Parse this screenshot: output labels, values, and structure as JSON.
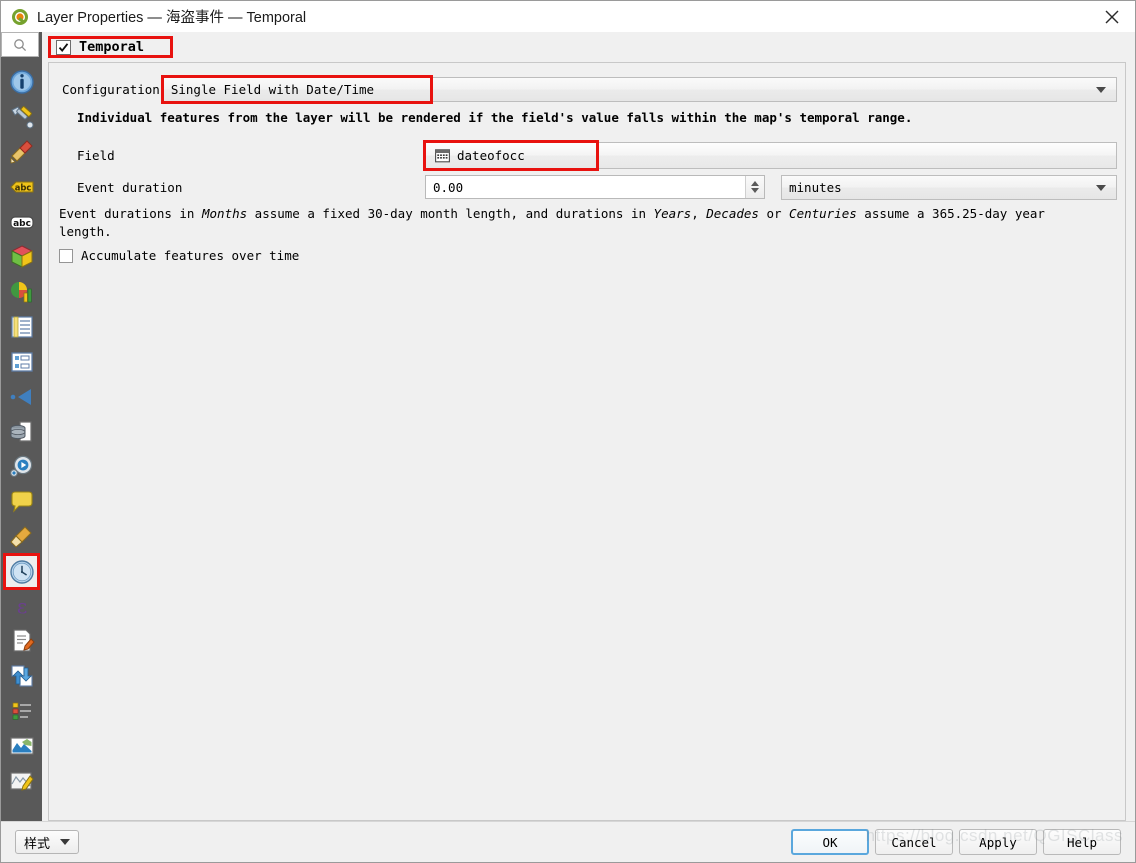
{
  "window": {
    "title": "Layer Properties — 海盗事件 — Temporal",
    "logo_icon": "qgis-logo-icon",
    "close_icon": "close-icon"
  },
  "sidebar": {
    "search": {
      "icon": "search-icon",
      "placeholder": ""
    },
    "items": [
      {
        "name": "information",
        "icon": "info-icon"
      },
      {
        "name": "source",
        "icon": "wrench-screwdriver-icon"
      },
      {
        "name": "symbology",
        "icon": "paintbrush-icon"
      },
      {
        "name": "labels",
        "icon": "abc-label-icon"
      },
      {
        "name": "masks",
        "icon": "abc-outline-icon"
      },
      {
        "name": "3d-view",
        "icon": "cube-icon"
      },
      {
        "name": "diagrams",
        "icon": "pie-bar-chart-icon"
      },
      {
        "name": "fields",
        "icon": "table-fields-icon"
      },
      {
        "name": "attributes-form",
        "icon": "form-layout-icon"
      },
      {
        "name": "joins",
        "icon": "join-arrow-icon"
      },
      {
        "name": "auxiliary-storage",
        "icon": "database-page-icon"
      },
      {
        "name": "actions",
        "icon": "gear-play-icon"
      },
      {
        "name": "display",
        "icon": "speech-balloon-icon"
      },
      {
        "name": "rendering",
        "icon": "broom-icon"
      },
      {
        "name": "temporal",
        "icon": "clock-icon",
        "selected": true
      },
      {
        "name": "variables",
        "icon": "epsilon-icon"
      },
      {
        "name": "metadata",
        "icon": "document-pencil-icon"
      },
      {
        "name": "dependencies",
        "icon": "sync-arrows-icon"
      },
      {
        "name": "legend",
        "icon": "legend-swatches-icon"
      },
      {
        "name": "qgis-server",
        "icon": "map-image-icon"
      },
      {
        "name": "digitizing",
        "icon": "map-pencil-icon"
      }
    ]
  },
  "panel": {
    "group_toggle_label": "Temporal",
    "group_toggle_checked": true,
    "configuration": {
      "label": "Configuration",
      "value": "Single Field with Date/Time"
    },
    "description_1": "Individual features from the layer will be rendered if the field's value falls within the map's temporal range.",
    "field": {
      "label": "Field",
      "value": "dateofocc",
      "icon": "calendar-icon"
    },
    "event_duration": {
      "label": "Event duration",
      "value": "0.00",
      "unit": "minutes"
    },
    "description_2_parts": [
      {
        "text": "Event durations in ",
        "italic": false
      },
      {
        "text": "Months",
        "italic": true
      },
      {
        "text": " assume a fixed 30-day month length, and durations in ",
        "italic": false
      },
      {
        "text": "Years",
        "italic": true
      },
      {
        "text": ", ",
        "italic": false
      },
      {
        "text": "Decades",
        "italic": true
      },
      {
        "text": " or ",
        "italic": false
      },
      {
        "text": "Centuries",
        "italic": true
      },
      {
        "text": " assume a 365.25-day year length.",
        "italic": false
      }
    ],
    "accumulate": {
      "label": "Accumulate features over time",
      "checked": false
    }
  },
  "bottom_bar": {
    "style_button": "样式",
    "style_arrow_icon": "chevron-down-icon",
    "buttons": [
      {
        "label": "OK",
        "default": true
      },
      {
        "label": "Cancel",
        "default": false
      },
      {
        "label": "Apply",
        "default": false
      },
      {
        "label": "Help",
        "default": false
      }
    ]
  },
  "watermark": "https://blog.csdn.net/QGISClass",
  "colors": {
    "highlight_red": "#e8120f",
    "sidebar_bg": "#595959",
    "panel_bg": "#f0f0f0",
    "default_button_border": "#5aa7dd"
  }
}
